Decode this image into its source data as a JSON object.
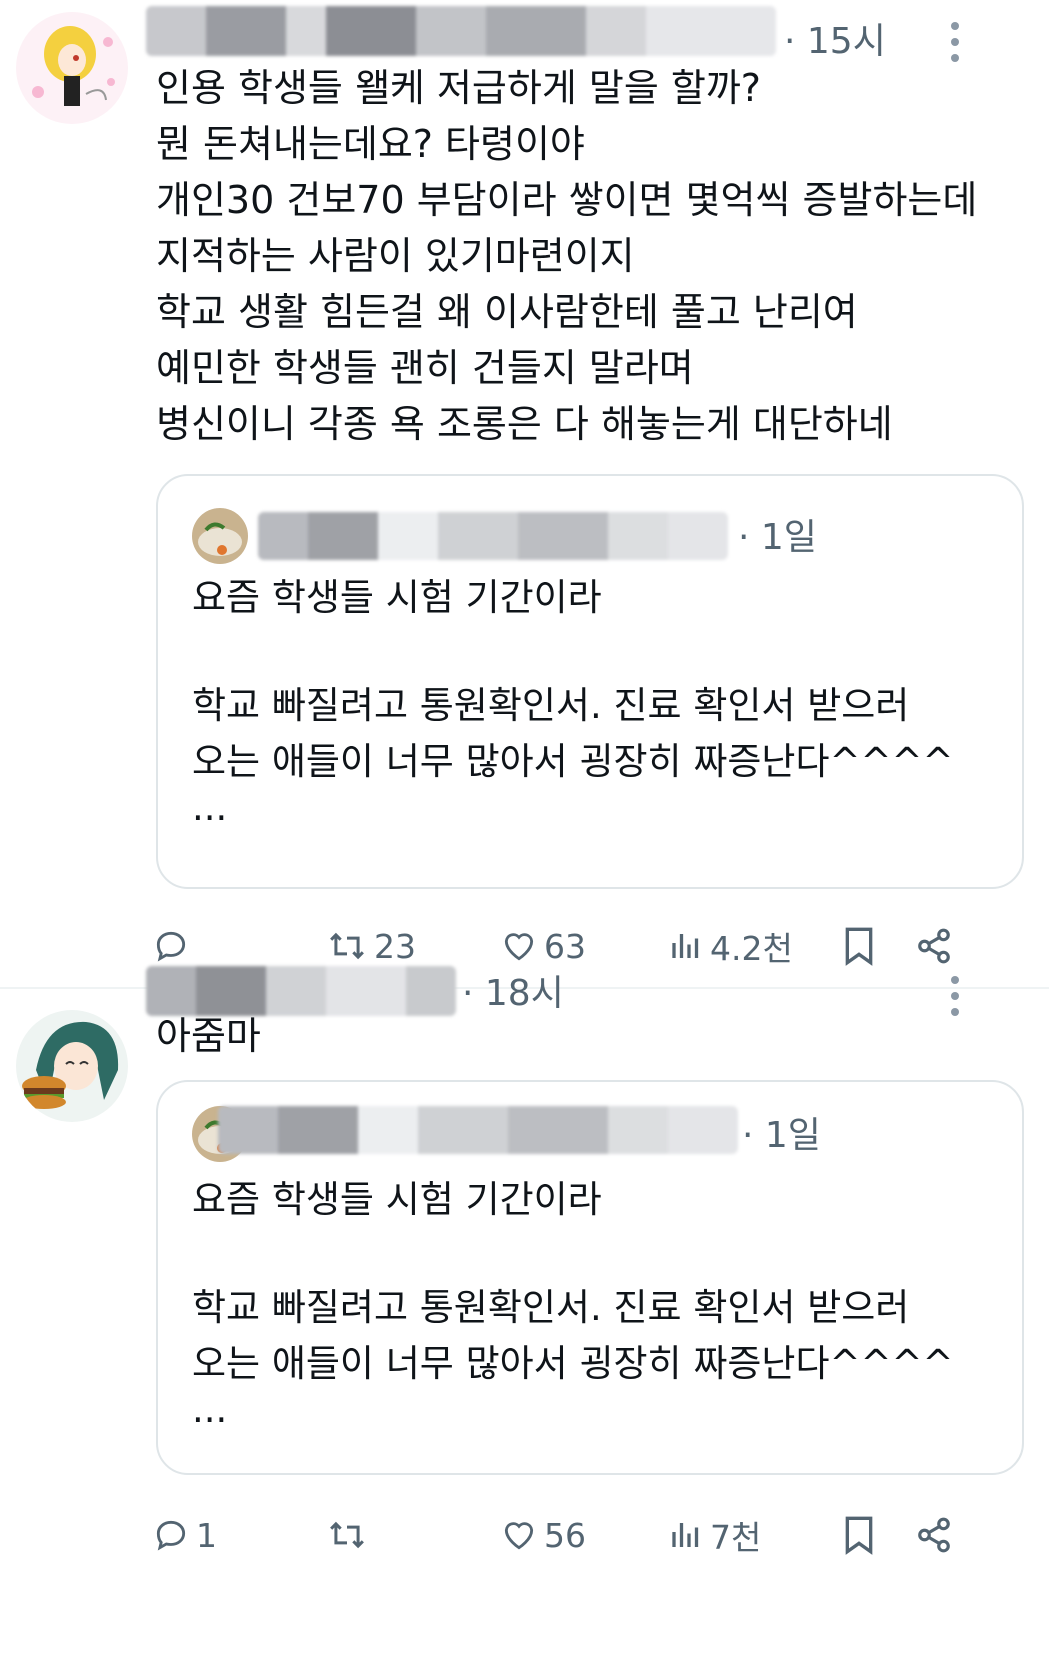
{
  "posts": [
    {
      "time": "· 15시",
      "text": [
        "인용 학생들 왤케 저급하게 말을 할까?",
        "뭔 돈쳐내는데요? 타령이야",
        "개인30 건보70 부담이라 쌓이면 몇억씩 증발하는데",
        "지적하는 사람이 있기마련이지",
        "학교 생활 힘든걸 왜 이사람한테 풀고 난리여",
        "예민한 학생들 괜히 건들지 말라며",
        "병신이니 각종 욕 조롱은 다 해놓는게 대단하네"
      ],
      "quote": {
        "time": "· 1일",
        "line1": "요즘 학생들 시험 기간이라",
        "line2": "학교 빠질려고 통원확인서. 진료 확인서 받으러",
        "line3": "오는 애들이 너무 많아서 굉장히 짜증난다^^^^",
        "ellipsis": "..."
      },
      "actions": {
        "reply": "",
        "retweet": "23",
        "like": "63",
        "views": "4.2천"
      }
    },
    {
      "time": "· 18시",
      "text": [
        "아줌마"
      ],
      "quote": {
        "time": "· 1일",
        "line1": "요즘 학생들 시험 기간이라",
        "line2": "학교 빠질려고 통원확인서. 진료 확인서 받으러",
        "line3": "오는 애들이 너무 많아서 굉장히 짜증난다^^^^",
        "ellipsis": "..."
      },
      "actions": {
        "reply": "1",
        "retweet": "",
        "like": "56",
        "views": "7천"
      }
    }
  ],
  "icons": {
    "reply": "reply-icon",
    "retweet": "retweet-icon",
    "like": "heart-icon",
    "views": "views-icon",
    "bookmark": "bookmark-icon",
    "share": "share-icon",
    "more": "more-vertical-icon"
  },
  "colors": {
    "text": "#0f1419",
    "secondary": "#536471",
    "border": "#dfe5e8"
  }
}
